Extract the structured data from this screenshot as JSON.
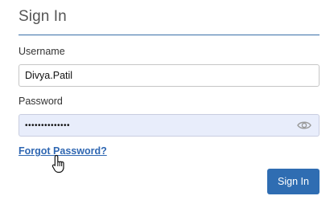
{
  "form": {
    "title": "Sign In",
    "username": {
      "label": "Username",
      "value": "Divya.Patil"
    },
    "password": {
      "label": "Password",
      "value": "••••••••••••••",
      "toggle_icon": "eye-icon"
    },
    "forgot_password_label": "Forgot Password?",
    "submit_label": "Sign In"
  },
  "colors": {
    "accent": "#2f6db2",
    "link": "#2f67b2",
    "autofill_bg": "#e8edfb"
  },
  "cursor": "hand-pointer-icon"
}
